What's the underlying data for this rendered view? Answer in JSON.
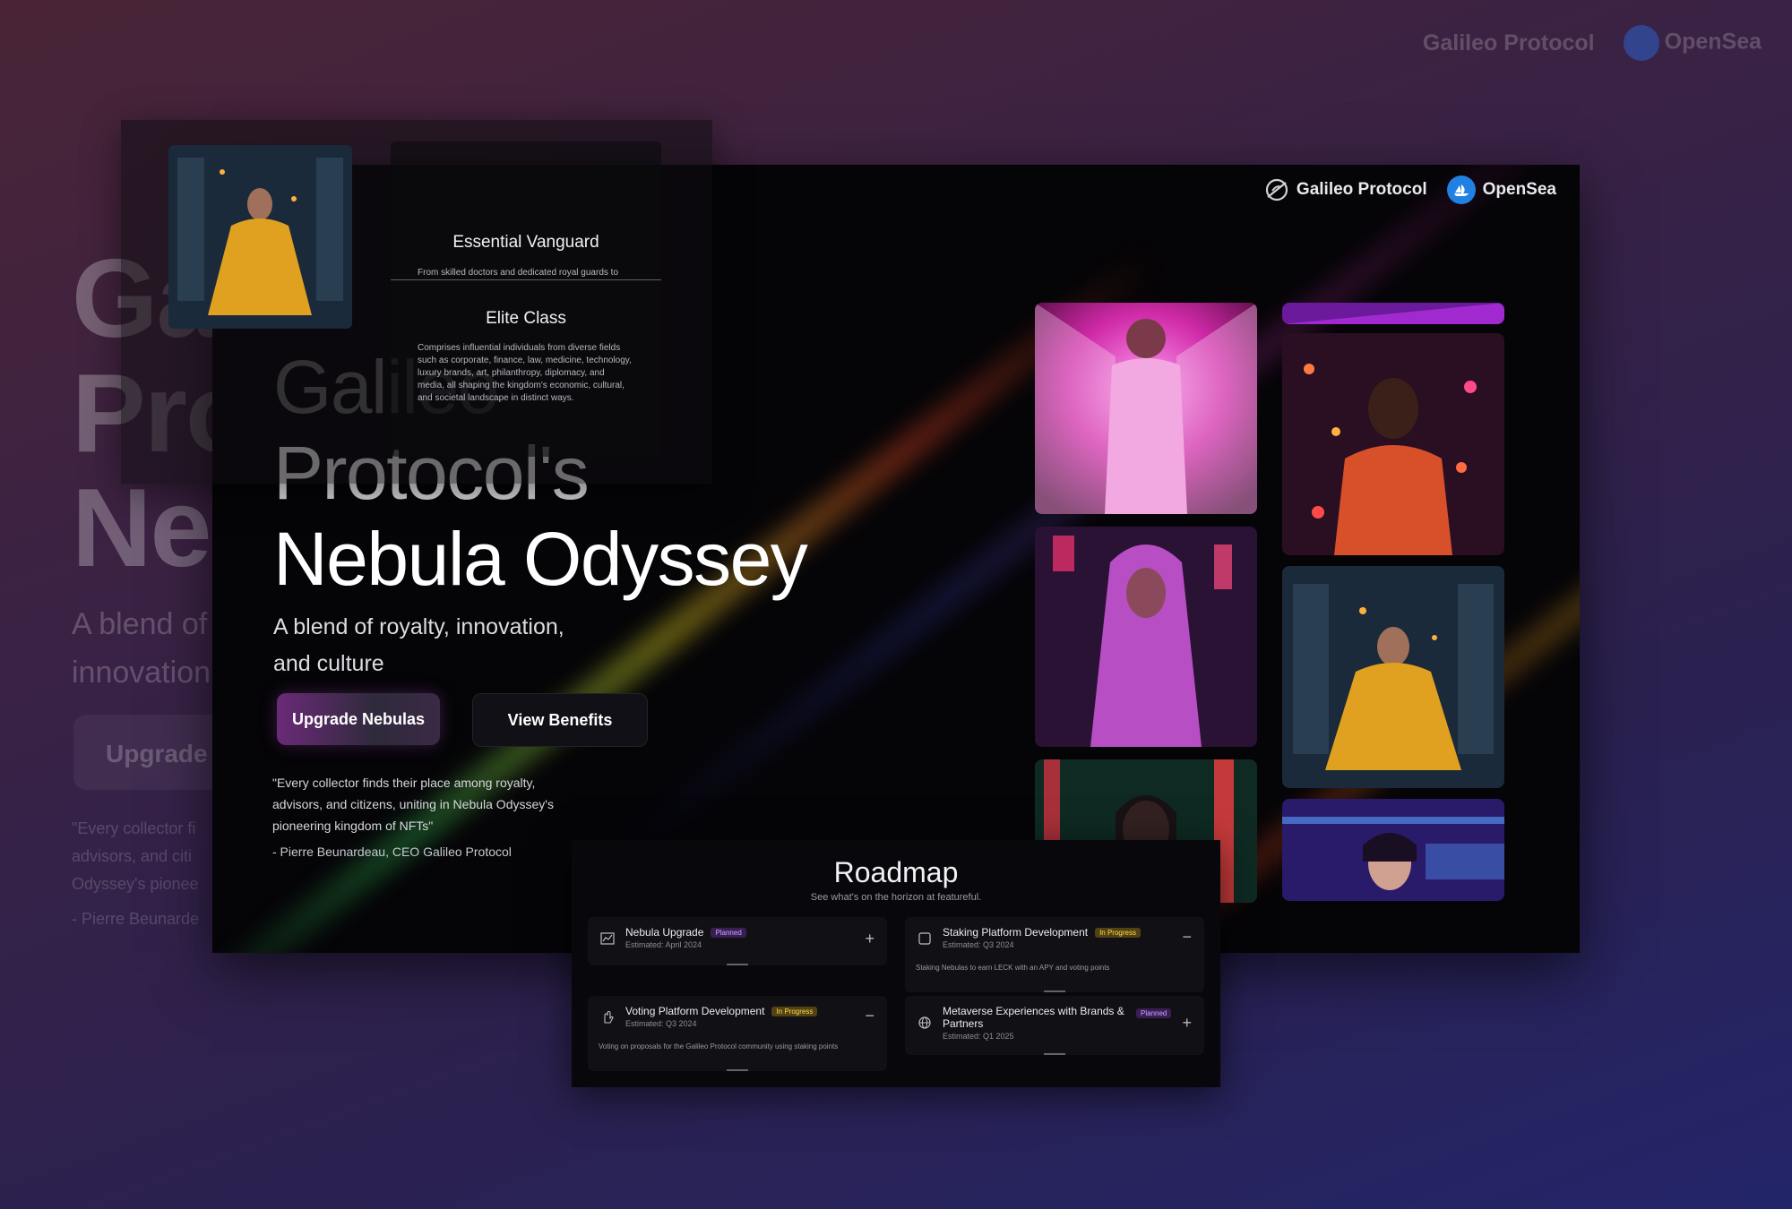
{
  "background": {
    "title_fragments": [
      "Ga",
      "Pro",
      "Nel"
    ],
    "subtitle_fragments": [
      "A blend of",
      "innovation"
    ],
    "button_fragment": "Upgrade N",
    "quote_fragments": [
      "\"Every collector fi",
      "advisors, and citi",
      "Odyssey's pionee",
      "- Pierre Beunarde"
    ],
    "brands": [
      "Galileo Protocol",
      "OpenSea"
    ]
  },
  "header": {
    "brand_galileo": "Galileo Protocol",
    "brand_opensea": "OpenSea"
  },
  "hero": {
    "title_line1": "Galileo",
    "title_line2": "Protocol's",
    "title_line3": "Nebula Odyssey",
    "subtitle": "A blend of royalty, innovation, and culture",
    "primary_button": "Upgrade Nebulas",
    "secondary_button": "View Benefits",
    "quote": "\"Every collector finds their place among royalty, advisors, and citizens, uniting in Nebula Odyssey's pioneering kingdom of NFTs\"",
    "author": "- Pierre Beunardeau, CEO Galileo Protocol"
  },
  "tiers": [
    {
      "title": "Essential Vanguard",
      "description": "From skilled doctors and dedicated royal guards to"
    },
    {
      "title": "Elite Class",
      "description": "Comprises influential individuals from diverse fields such as corporate, finance, law, medicine, technology, luxury brands, art, philanthropy, diplomacy, and media, all shaping the kingdom's economic, cultural, and societal landscape in distinct ways."
    }
  ],
  "roadmap": {
    "title": "Roadmap",
    "subtitle": "See what's on the horizon at featureful.",
    "items": [
      {
        "name": "Nebula Upgrade",
        "status": "Planned",
        "estimate": "Estimated: April 2024",
        "toggle": "+",
        "detail": "",
        "icon": "chart-icon"
      },
      {
        "name": "Staking Platform Development",
        "status": "In Progress",
        "estimate": "Estimated: Q3 2024",
        "toggle": "−",
        "detail": "Staking Nebulas to earn LECK with an APY and voting points",
        "icon": "square-icon"
      },
      {
        "name": "Voting Platform Development",
        "status": "In Progress",
        "estimate": "Estimated: Q3 2024",
        "toggle": "−",
        "detail": "Voting on proposals for the Galileo Protocol community using staking points",
        "icon": "hand-icon"
      },
      {
        "name": "Metaverse Experiences with Brands & Partners",
        "status": "Planned",
        "estimate": "Estimated: Q1 2025",
        "toggle": "+",
        "detail": "",
        "icon": "globe-icon"
      }
    ]
  },
  "colors": {
    "accent_pink": "#e040c8",
    "opensea_blue": "#2081e2",
    "badge_planned": "#c9a4ff",
    "badge_progress": "#ffd84a"
  }
}
